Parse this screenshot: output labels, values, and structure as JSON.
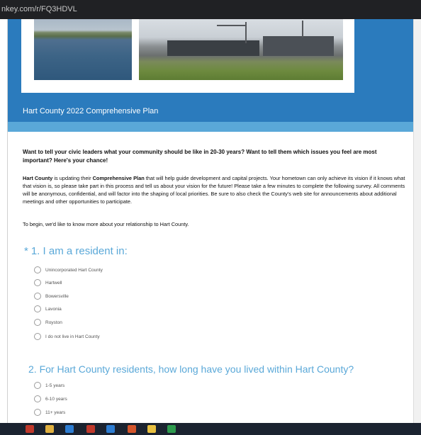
{
  "browser": {
    "url": "nkey.com/r/FQ3HDVL"
  },
  "header": {
    "title": "Hart County 2022 Comprehensive Plan"
  },
  "intro": {
    "bold_line": "Want to tell your civic leaders what your community should be like in 20-30 years?  Want to tell them which issues you feel are most important?  Here's your chance!",
    "para_lead": "Hart County",
    "para_mid1": " is updating their ",
    "para_plan": "Comprehensive Plan",
    "para_rest": " that will help guide development and capital projects.  Your hometown can only achieve its vision if it knows what that vision is, so please take part in this process and tell us about your vision for the future!  Please take a few minutes to complete the following survey.  All comments will be anonymous, confidential, and will factor into the shaping of local priorities.  Be sure to also check the County's web site for announcements about additional meetings and other opportunities to participate.",
    "begin": "To begin, we'd like to know more about your relationship to Hart County."
  },
  "q1": {
    "required_mark": "*",
    "title": "1. I am a resident in:",
    "options": [
      "Unincorporated Hart County",
      "Hartwell",
      "Bowersville",
      "Lavonia",
      "Royston",
      "I do not live in Hart County"
    ]
  },
  "q2": {
    "title": "2. For Hart County residents, how long have you lived within Hart County?",
    "options": [
      "1-5 years",
      "6-10 years",
      "11+ years"
    ]
  },
  "colors": {
    "header_blue": "#2b7bbd",
    "band_blue": "#5aa8d8",
    "question_blue": "#5aa8d8"
  }
}
